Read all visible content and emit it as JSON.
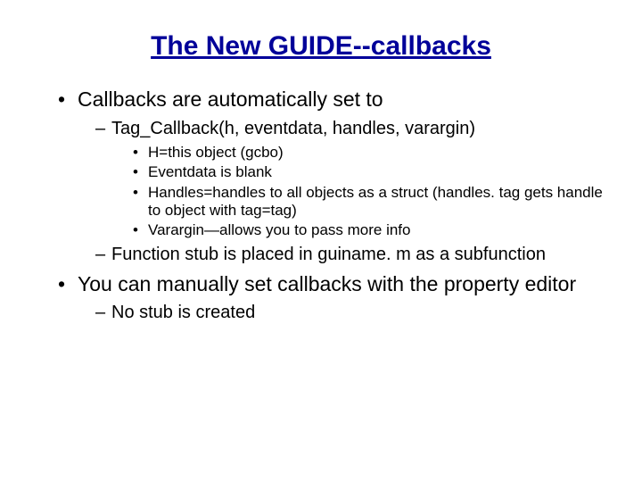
{
  "title": "The New GUIDE--callbacks",
  "bullets": [
    {
      "text": "Callbacks are automatically set to",
      "sub": [
        {
          "text": "Tag_Callback(h, eventdata, handles, varargin)",
          "sub": [
            {
              "text": "H=this object (gcbo)"
            },
            {
              "text": "Eventdata is blank"
            },
            {
              "text": "Handles=handles to all objects as a struct (handles. tag gets handle to object with tag=tag)"
            },
            {
              "text": "Varargin—allows you to pass more info"
            }
          ]
        },
        {
          "text": "Function stub is placed in guiname. m as a subfunction"
        }
      ]
    },
    {
      "text": "You can manually set callbacks with the property editor",
      "sub": [
        {
          "text": "No stub is created"
        }
      ]
    }
  ]
}
